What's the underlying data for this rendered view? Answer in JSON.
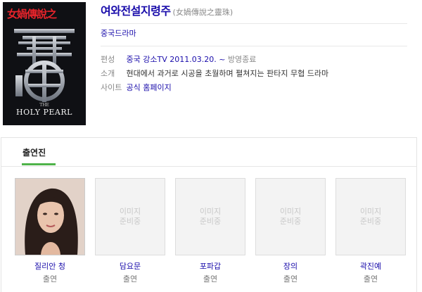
{
  "poster": {
    "jp_title": "女媧傳說之",
    "en_the": "THE",
    "en_title": "HOLY PEARL"
  },
  "header": {
    "title_main": "여와전설지령주",
    "title_sub": "(女媧傳說之靈珠)",
    "genre": "중국드라마"
  },
  "info": {
    "broadcast_label": "편성",
    "broadcast_channel": "중국 강소TV",
    "broadcast_date": "2011.03.20. ~",
    "broadcast_status": "방영종료",
    "summary_label": "소개",
    "summary_text": "현대에서 과거로 시공을 초월하며 펼쳐지는 판타지 무협 드라마",
    "site_label": "사이트",
    "site_link": "공식 홈페이지"
  },
  "cast": {
    "tab_label": "출연진",
    "placeholder_line1": "이미지",
    "placeholder_line2": "준비중",
    "members": [
      {
        "name": "질리안 청",
        "role": "출연",
        "has_photo": true
      },
      {
        "name": "담요문",
        "role": "출연",
        "has_photo": false
      },
      {
        "name": "포파갑",
        "role": "출연",
        "has_photo": false
      },
      {
        "name": "장의",
        "role": "출연",
        "has_photo": false
      },
      {
        "name": "곽진예",
        "role": "출연",
        "has_photo": false
      }
    ]
  }
}
